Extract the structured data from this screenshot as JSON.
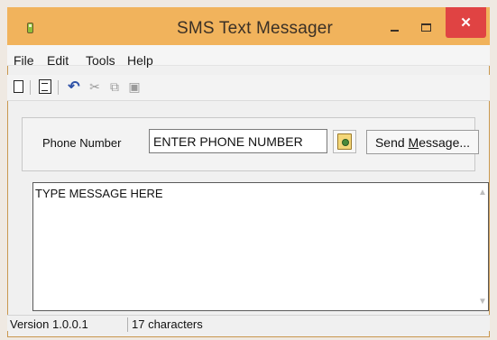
{
  "window": {
    "title": "SMS Text Messager",
    "close_glyph": "✕"
  },
  "menu": [
    "File",
    "Edit",
    "Tools",
    "Help"
  ],
  "toolbar": {
    "icons": [
      "new-file-icon",
      "document-icon",
      "undo-icon",
      "cut-icon",
      "copy-icon",
      "paste-icon"
    ],
    "undo_glyph": "↶",
    "cut_glyph": "✂",
    "copy_glyph": "⧉",
    "paste_glyph": "▣"
  },
  "phone": {
    "label": "Phone Number",
    "value": "ENTER PHONE NUMBER"
  },
  "send": {
    "pre": "Send ",
    "key": "M",
    "post": "essage..."
  },
  "message": {
    "value": "TYPE MESSAGE HERE"
  },
  "scroll": {
    "up": "▲",
    "down": "▼"
  },
  "status": {
    "version": "Version 1.0.0.1",
    "count": "17 characters"
  },
  "colors": {
    "titlebar": "#f1b35c",
    "close": "#e04343",
    "window_bg": "#f0f0f0"
  }
}
